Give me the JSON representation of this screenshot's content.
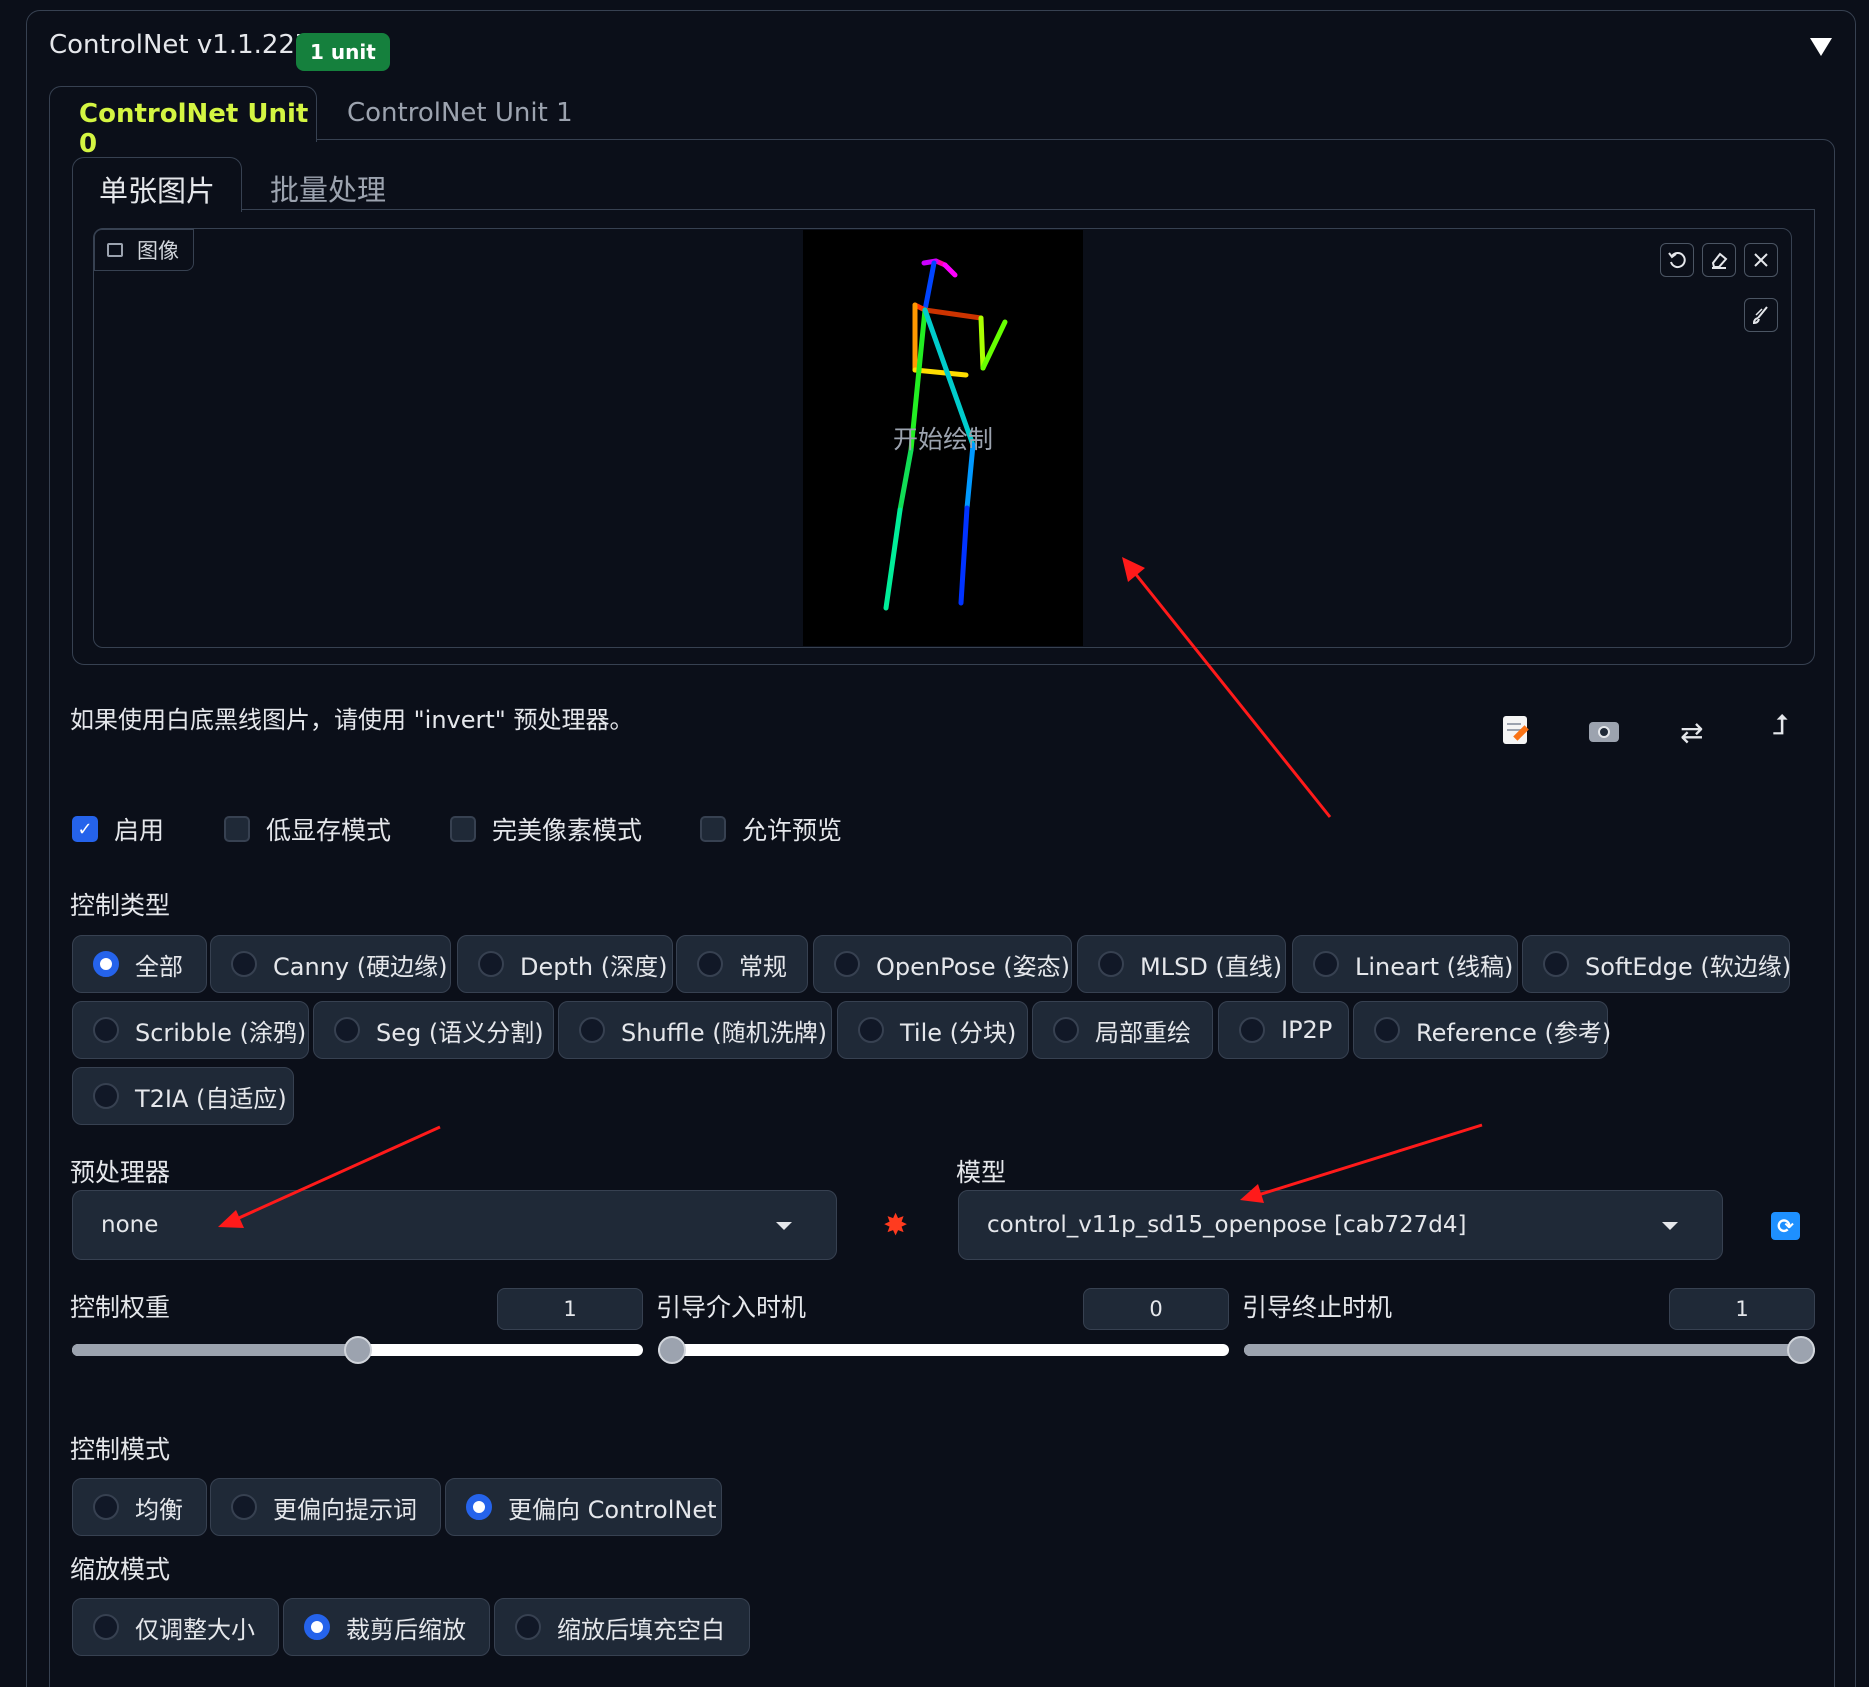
{
  "header": {
    "title": "ControlNet v1.1.227",
    "badge": "1 unit",
    "collapse_icon": "triangle-down-icon"
  },
  "unit_tabs": [
    {
      "label": "ControlNet Unit 0",
      "active": true
    },
    {
      "label": "ControlNet Unit 1",
      "active": false
    }
  ],
  "mode_tabs": [
    {
      "label": "单张图片",
      "active": true
    },
    {
      "label": "批量处理",
      "active": false
    }
  ],
  "image": {
    "label": "图像",
    "overlay_text": "开始绘制",
    "tools": [
      "undo-icon",
      "eraser-icon",
      "close-icon",
      "brush-icon"
    ]
  },
  "hint": "如果使用白底黑线图片，请使用 \"invert\" 预处理器。",
  "action_icons": [
    "memo-icon",
    "camera-icon",
    "swap-icon",
    "send-icon"
  ],
  "checkboxes": [
    {
      "label": "启用",
      "checked": true
    },
    {
      "label": "低显存模式",
      "checked": false
    },
    {
      "label": "完美像素模式",
      "checked": false
    },
    {
      "label": "允许预览",
      "checked": false
    }
  ],
  "control_type": {
    "label": "控制类型",
    "options": [
      {
        "label": "全部",
        "selected": true
      },
      {
        "label": "Canny (硬边缘)",
        "selected": false
      },
      {
        "label": "Depth (深度)",
        "selected": false
      },
      {
        "label": "常规",
        "selected": false
      },
      {
        "label": "OpenPose (姿态)",
        "selected": false
      },
      {
        "label": "MLSD (直线)",
        "selected": false
      },
      {
        "label": "Lineart (线稿)",
        "selected": false
      },
      {
        "label": "SoftEdge (软边缘)",
        "selected": false
      },
      {
        "label": "Scribble (涂鸦)",
        "selected": false
      },
      {
        "label": "Seg (语义分割)",
        "selected": false
      },
      {
        "label": "Shuffle (随机洗牌)",
        "selected": false
      },
      {
        "label": "Tile (分块)",
        "selected": false
      },
      {
        "label": "局部重绘",
        "selected": false
      },
      {
        "label": "IP2P",
        "selected": false
      },
      {
        "label": "Reference (参考)",
        "selected": false
      },
      {
        "label": "T2IA (自适应)",
        "selected": false
      }
    ]
  },
  "preprocessor": {
    "label": "预处理器",
    "value": "none",
    "run_icon": "explosion-icon"
  },
  "model": {
    "label": "模型",
    "value": "control_v11p_sd15_openpose [cab727d4]",
    "refresh_icon": "refresh-icon"
  },
  "sliders": [
    {
      "label": "控制权重",
      "value": "1",
      "fraction": 0.5
    },
    {
      "label": "引导介入时机",
      "value": "0",
      "fraction": 0.0
    },
    {
      "label": "引导终止时机",
      "value": "1",
      "fraction": 1.0
    }
  ],
  "control_mode": {
    "label": "控制模式",
    "options": [
      {
        "label": "均衡",
        "selected": false
      },
      {
        "label": "更偏向提示词",
        "selected": false
      },
      {
        "label": "更偏向 ControlNet",
        "selected": true
      }
    ]
  },
  "resize_mode": {
    "label": "缩放模式",
    "options": [
      {
        "label": "仅调整大小",
        "selected": false
      },
      {
        "label": "裁剪后缩放",
        "selected": true
      },
      {
        "label": "缩放后填充空白",
        "selected": false
      }
    ]
  },
  "colors": {
    "accent": "#2563eb",
    "active_tab": "#d4f542",
    "badge": "#15803d",
    "annotation_arrow": "#ff1a1a"
  }
}
